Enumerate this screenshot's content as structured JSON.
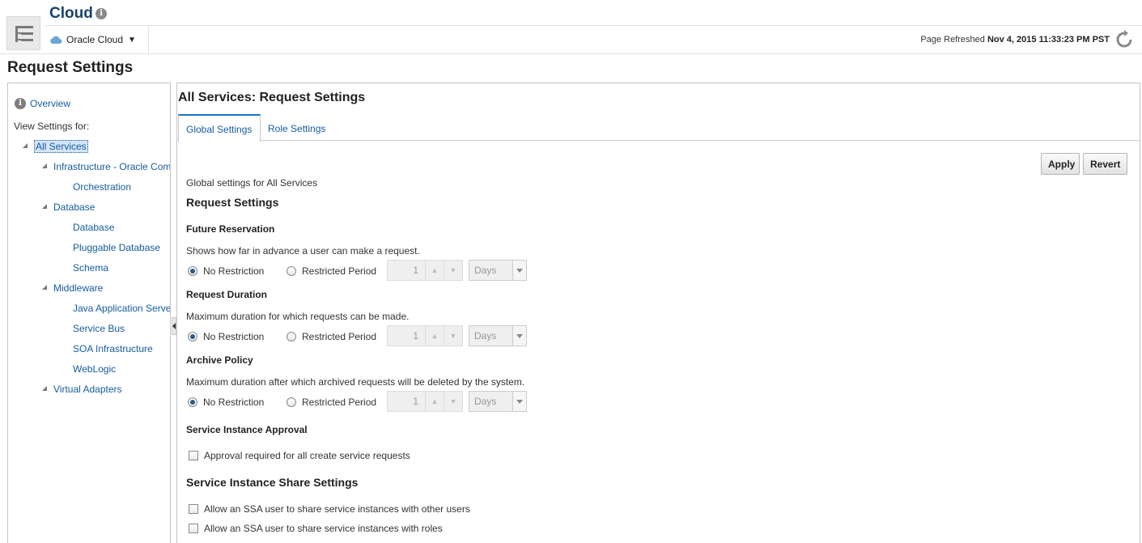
{
  "header": {
    "app_title": "Cloud",
    "target_menu": "Oracle Cloud",
    "refresh_label": "Page Refreshed",
    "refresh_time": "Nov 4, 2015 11:33:23 PM PST"
  },
  "page_title": "Request Settings",
  "left_panel": {
    "overview": "Overview",
    "view_settings_for": "View Settings for:",
    "tree": {
      "all_services": "All Services",
      "infrastructure": "Infrastructure - Oracle Compute",
      "orchestration": "Orchestration",
      "database_group": "Database",
      "database": "Database",
      "pluggable_database": "Pluggable Database",
      "schema": "Schema",
      "middleware": "Middleware",
      "java_app_server": "Java Application Server",
      "service_bus": "Service Bus",
      "soa_infrastructure": "SOA Infrastructure",
      "weblogic": "WebLogic",
      "virtual_adapters": "Virtual Adapters"
    }
  },
  "main": {
    "title": "All Services: Request Settings",
    "tabs": [
      "Global Settings",
      "Role Settings"
    ],
    "apply": "Apply",
    "revert": "Revert",
    "global_caption": "Global settings for All Services",
    "section_title": "Request Settings",
    "future_reservation": {
      "title": "Future Reservation",
      "desc": "Shows how far in advance a user can make a request.",
      "option_none": "No Restriction",
      "option_period": "Restricted Period",
      "value": "1",
      "unit": "Days"
    },
    "request_duration": {
      "title": "Request Duration",
      "desc": "Maximum duration for which requests can be made.",
      "option_none": "No Restriction",
      "option_period": "Restricted Period",
      "value": "1",
      "unit": "Days"
    },
    "archive_policy": {
      "title": "Archive Policy",
      "desc": "Maximum duration after which archived requests will be deleted by the system.",
      "option_none": "No Restriction",
      "option_period": "Restricted Period",
      "value": "1",
      "unit": "Days"
    },
    "approval": {
      "title": "Service Instance Approval",
      "checkbox": "Approval required for all create service requests"
    },
    "share": {
      "title": "Service Instance Share Settings",
      "share_users": "Allow an SSA user to share service instances with other users",
      "share_roles": "Allow an SSA user to share service instances with roles"
    }
  },
  "colors": {
    "link": "#145c9e",
    "title_blue": "#16436b",
    "tab_accent": "#1a73c0"
  }
}
